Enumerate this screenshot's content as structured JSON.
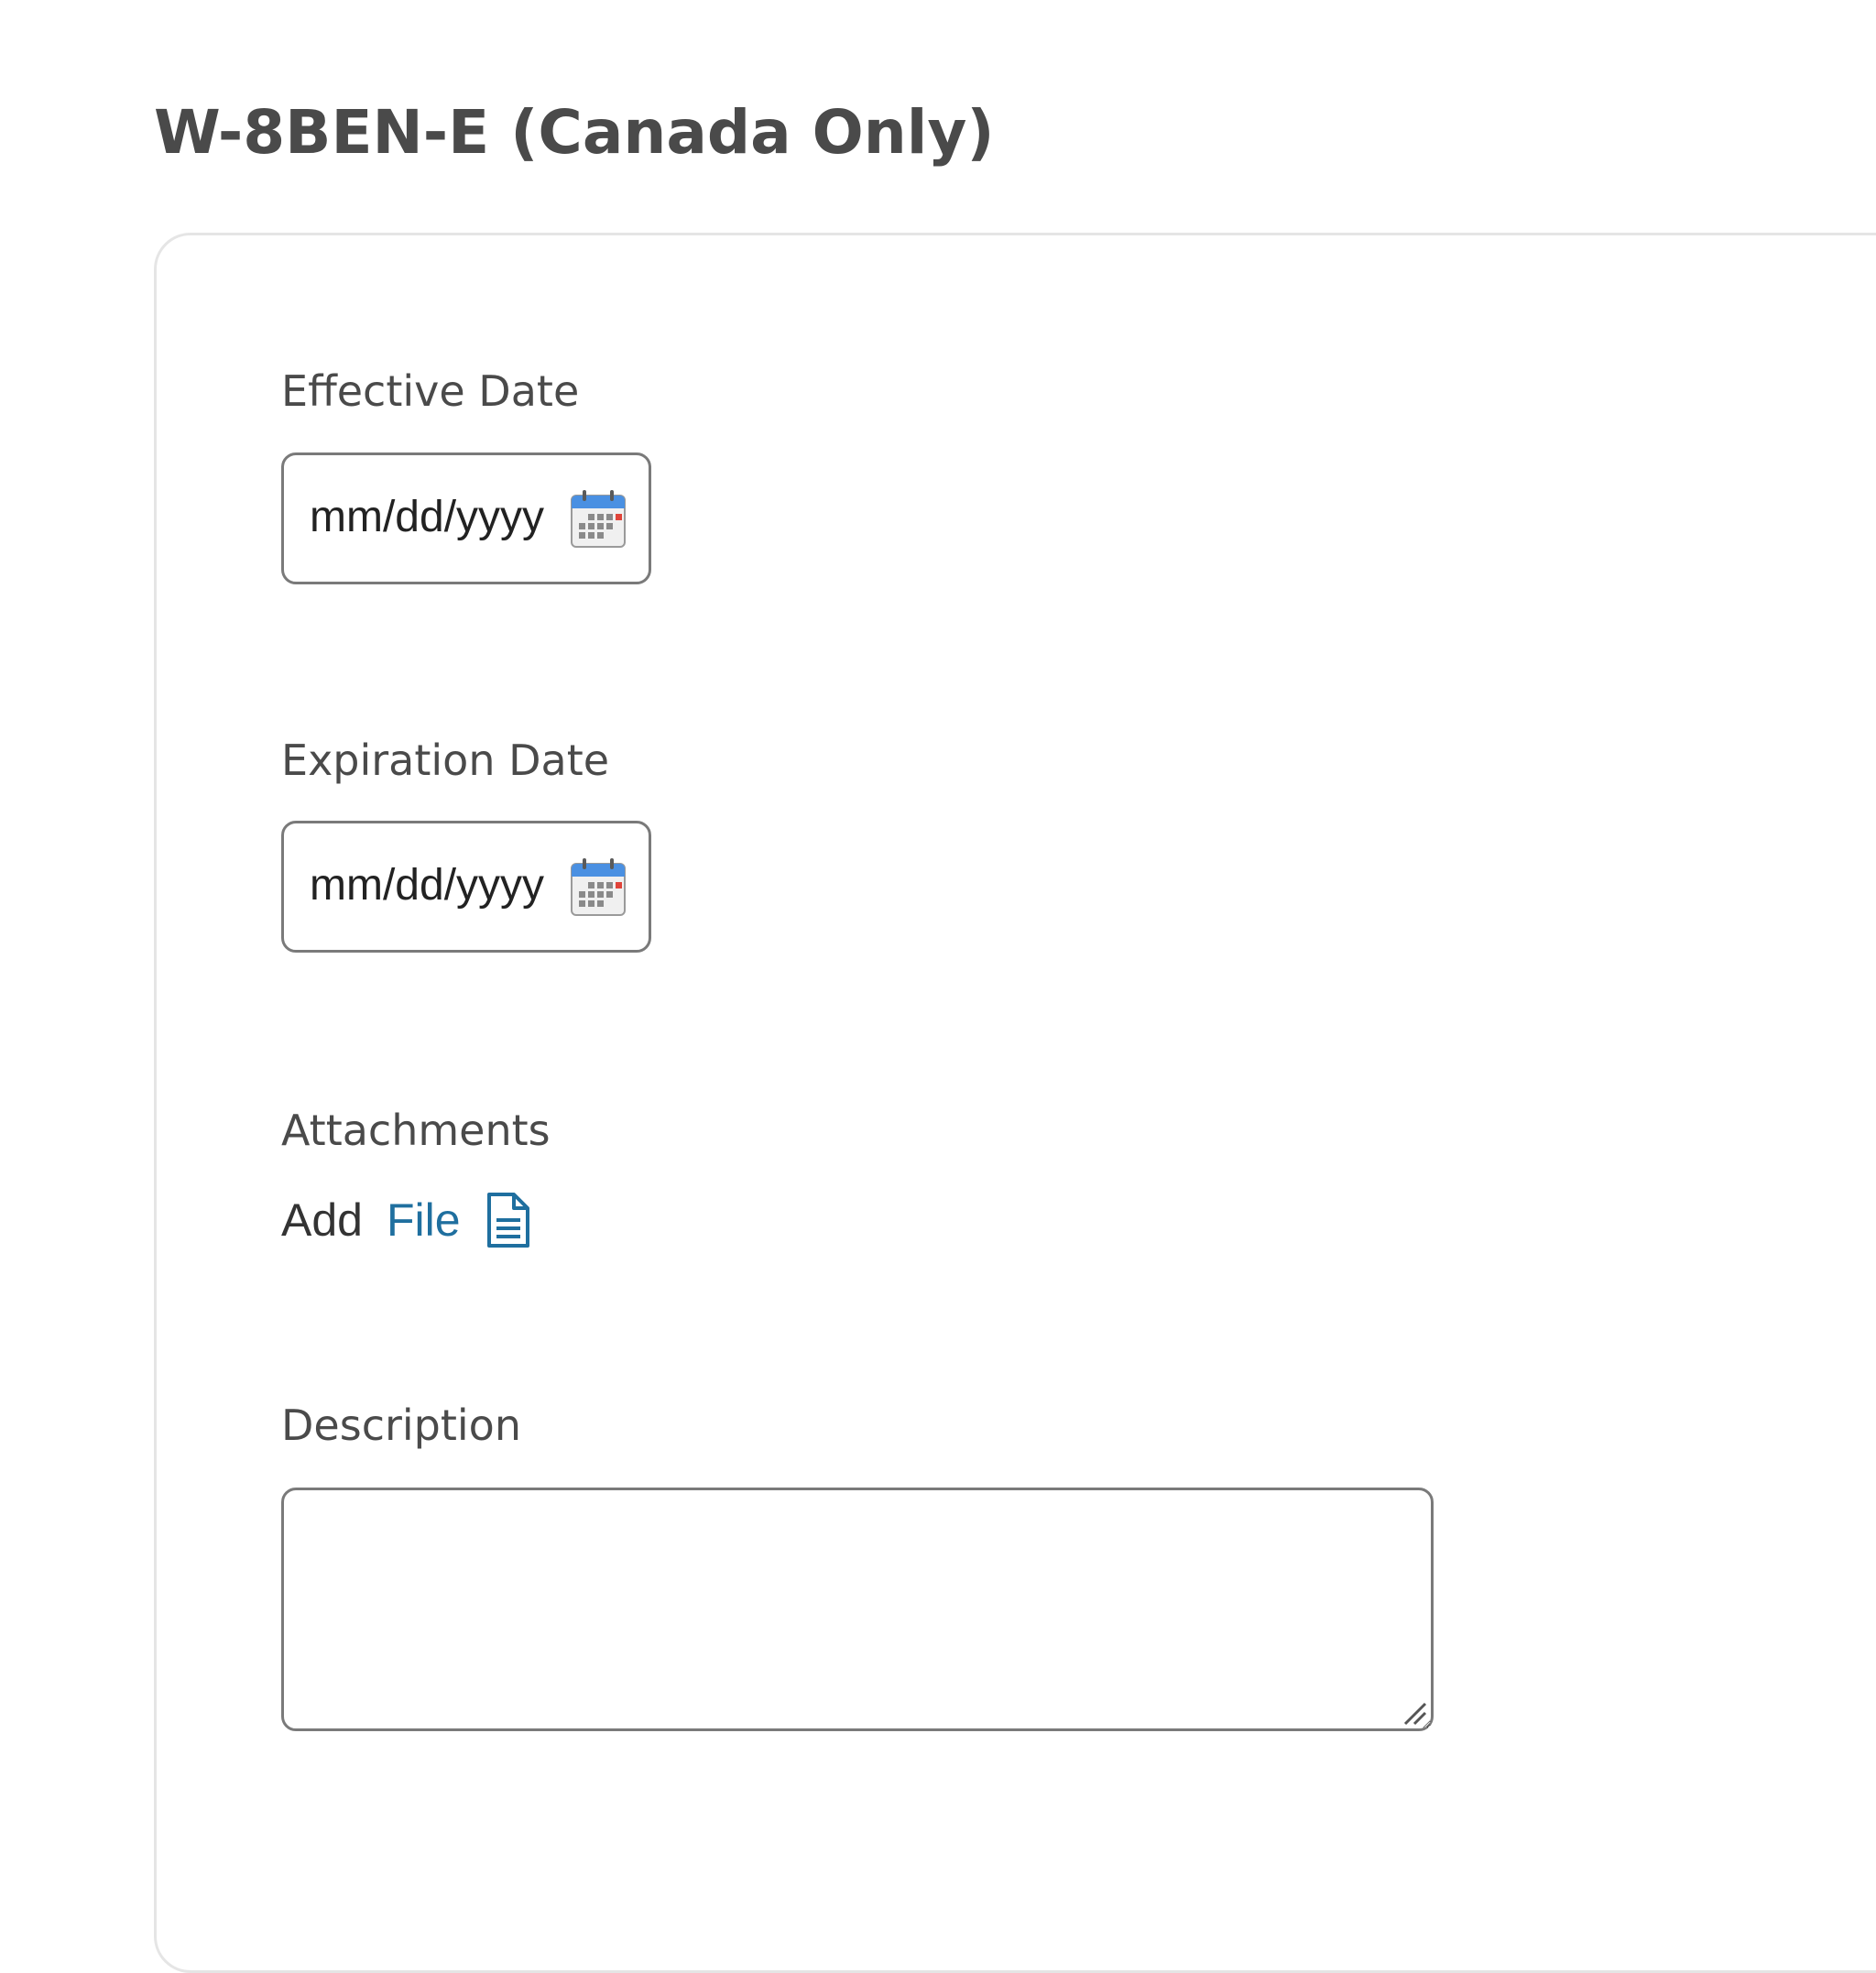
{
  "page": {
    "title": "W-8BEN-E (Canada Only)"
  },
  "form": {
    "effective_date": {
      "label": "Effective Date",
      "placeholder": "mm/dd/yyyy",
      "icon": "calendar-icon"
    },
    "expiration_date": {
      "label": "Expiration Date",
      "placeholder": "mm/dd/yyyy",
      "icon": "calendar-icon"
    },
    "attachments": {
      "label": "Attachments",
      "add_text": "Add",
      "file_link": "File",
      "icon": "document-icon"
    },
    "description": {
      "label": "Description",
      "value": ""
    }
  },
  "colors": {
    "text": "#4a4a4a",
    "link": "#1f6f9f",
    "input_border": "#7a7a7a",
    "panel_border": "#e5e5e5",
    "calendar_header": "#4a90e2"
  }
}
